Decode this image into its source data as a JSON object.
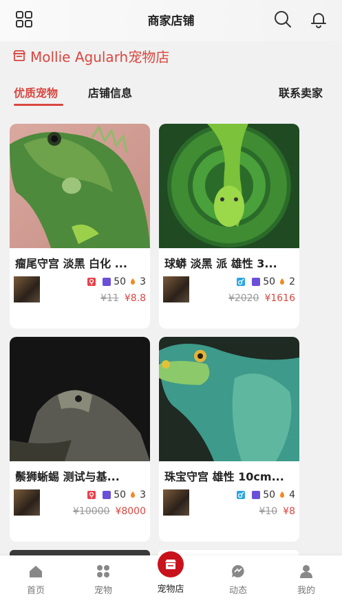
{
  "header": {
    "title": "商家店铺",
    "menu_icon": "grid-icon",
    "search_icon": "search-icon",
    "bell_icon": "bell-icon"
  },
  "shop": {
    "icon": "store-icon",
    "name": "Mollie Agularh宠物店"
  },
  "tabs": [
    {
      "label": "优质宠物",
      "active": true
    },
    {
      "label": "店铺信息",
      "active": false
    },
    {
      "label": "联系卖家",
      "active": false
    }
  ],
  "products": [
    {
      "name": "瘤尾守宫 淡黑 白化 ...",
      "gender_icon": "female-icon",
      "gender_color": "#e8404a",
      "count": "50",
      "likes": "3",
      "old_price": "¥11",
      "price": "¥8.8"
    },
    {
      "name": "球蟒 淡黑 派 雄性 3...",
      "gender_icon": "male-icon",
      "gender_color": "#2aa6e0",
      "count": "50",
      "likes": "2",
      "old_price": "¥2020",
      "price": "¥1616"
    },
    {
      "name": "鬃狮蜥蜴 测试与基...",
      "gender_icon": "female-icon",
      "gender_color": "#e8404a",
      "count": "50",
      "likes": "3",
      "old_price": "¥10000",
      "price": "¥8000"
    },
    {
      "name": "珠宝守宫 雄性 10cm...",
      "gender_icon": "male-icon",
      "gender_color": "#2aa6e0",
      "count": "50",
      "likes": "4",
      "old_price": "¥10",
      "price": "¥8"
    }
  ],
  "nav": [
    {
      "label": "首页",
      "icon": "home-icon"
    },
    {
      "label": "宠物",
      "icon": "pets-grid-icon"
    },
    {
      "label": "宠物店",
      "icon": "store-icon",
      "active": true
    },
    {
      "label": "动态",
      "icon": "chat-icon"
    },
    {
      "label": "我的",
      "icon": "user-icon"
    }
  ],
  "colors": {
    "accent": "#d9463f",
    "nav_active": "#c8121c",
    "count_badge": "#6a4fd8",
    "like_badge": "#f08a24"
  }
}
